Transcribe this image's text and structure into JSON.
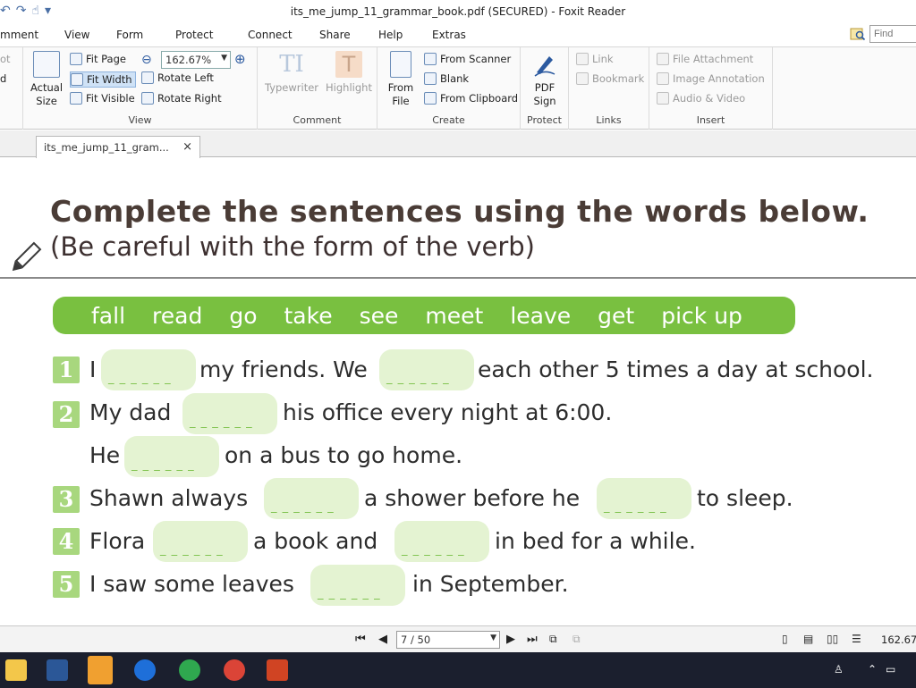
{
  "window": {
    "title": "its_me_jump_11_grammar_book.pdf (SECURED) - Foxit Reader"
  },
  "menu": {
    "tabs": [
      "mment",
      "View",
      "Form",
      "Protect",
      "Connect",
      "Share",
      "Help",
      "Extras"
    ],
    "find_placeholder": "Find"
  },
  "ribbon": {
    "left_cut": [
      "ot",
      "d"
    ],
    "view": {
      "actual_size": "Actual Size",
      "fit_page": "Fit Page",
      "fit_width": "Fit Width",
      "fit_visible": "Fit Visible",
      "zoom": "162.67%",
      "rotate_left": "Rotate Left",
      "rotate_right": "Rotate Right",
      "label": "View"
    },
    "comment": {
      "typewriter": "Typewriter",
      "highlight": "Highlight",
      "label": "Comment"
    },
    "create": {
      "from_file": "From File",
      "from_scanner": "From Scanner",
      "blank": "Blank",
      "from_clipboard": "From Clipboard",
      "label": "Create"
    },
    "protect": {
      "pdf_sign": "PDF Sign",
      "label": "Protect"
    },
    "links": {
      "link": "Link",
      "bookmark": "Bookmark",
      "label": "Links"
    },
    "insert": {
      "file_attachment": "File Attachment",
      "image_annotation": "Image Annotation",
      "audio_video": "Audio & Video",
      "label": "Insert"
    }
  },
  "doc_tab": {
    "name": "its_me_jump_11_gram...",
    "close": "×"
  },
  "page": {
    "heading": "Complete the sentences using the words below.",
    "subheading": "(Be careful with the form of the verb)",
    "word_bank": [
      "fall",
      "read",
      "go",
      "take",
      "see",
      "meet",
      "leave",
      "get",
      "pick up"
    ],
    "items": [
      {
        "num": "1",
        "parts": [
          "I",
          "my friends. We",
          "each other 5 times a day at school."
        ]
      },
      {
        "num": "2",
        "parts": [
          "My dad",
          "his office every night at 6:00."
        ]
      },
      {
        "num": "",
        "parts": [
          "He",
          "on a bus to go home."
        ]
      },
      {
        "num": "3",
        "parts": [
          "Shawn always",
          "a shower before he",
          "to sleep."
        ]
      },
      {
        "num": "4",
        "parts": [
          "Flora",
          "a book and",
          "in bed for a while."
        ]
      },
      {
        "num": "5",
        "parts": [
          "I saw some leaves",
          "in September."
        ]
      }
    ]
  },
  "status": {
    "page": "7 / 50",
    "zoom": "162.67"
  },
  "colors": {
    "accent_green": "#79c040",
    "blank_fill": "#e4f3d2",
    "number_badge": "#a8d77e",
    "heading_text": "#4a3c36"
  }
}
